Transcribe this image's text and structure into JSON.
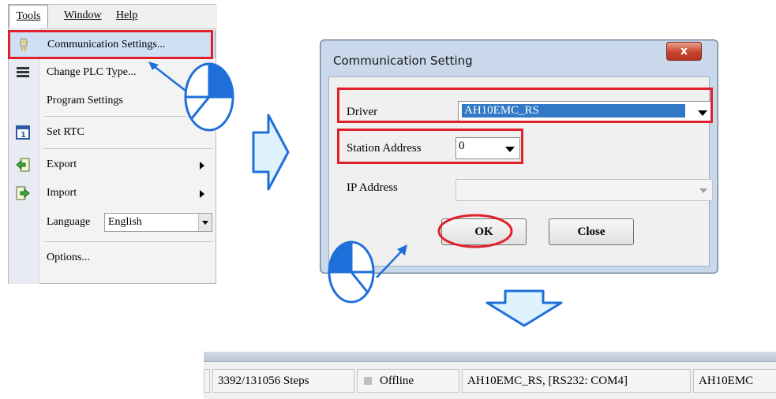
{
  "menubar": {
    "tools": "Tools",
    "window": "Window",
    "help": "Help"
  },
  "tools_menu": {
    "items": [
      {
        "label": "Communication Settings...",
        "icon": "plug-icon"
      },
      {
        "label": "Change PLC Type...",
        "icon": "plc-type-icon"
      },
      {
        "label": "Program Settings",
        "icon": ""
      },
      {
        "label": "Set RTC",
        "icon": "calendar-icon"
      },
      {
        "label": "Export",
        "icon": "export-icon"
      },
      {
        "label": "Import",
        "icon": "import-icon"
      },
      {
        "label": "Language",
        "icon": ""
      },
      {
        "label": "Options...",
        "icon": ""
      }
    ],
    "language_value": "English"
  },
  "dialog": {
    "title": "Communication Setting",
    "close_glyph": "x",
    "driver_label": "Driver",
    "driver_value": "AH10EMC_RS",
    "station_label": "Station Address",
    "station_value": "0",
    "ip_label": "IP Address",
    "ip_value": "",
    "ok_label": "OK",
    "close_label": "Close"
  },
  "statusbar": {
    "steps": "3392/131056 Steps",
    "status": "Offline",
    "connection": "AH10EMC_RS, [RS232: COM4]",
    "model": "AH10EMC"
  },
  "colors": {
    "highlight_red": "#e0202a",
    "accent_blue": "#1e6fd9",
    "arrow_fill": "#dff3ff"
  }
}
